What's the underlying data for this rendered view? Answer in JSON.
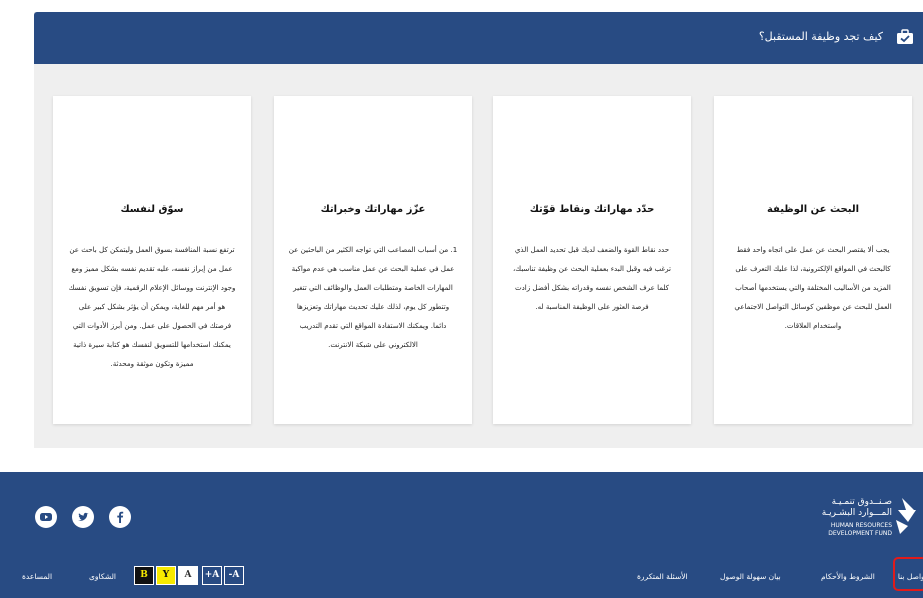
{
  "section": {
    "title": "كيف تجد وظيفة المستقبل؟",
    "icon": "briefcase-check-icon"
  },
  "cards": [
    {
      "title": "البحث عن الوظيفة",
      "body": "يجب ألا يقتصر البحث عن عمل على اتجاه واحد فقط كالبحث في المواقع الإلكترونية، لذا عليك التعرف على المزيد من الأساليب المختلفة والتي يستخدمها أصحاب العمل للبحث عن موظفين كوسائل التواصل الاجتماعي واستخدام العلاقات."
    },
    {
      "title": "حدّد مهاراتك ونقاط قوّتك",
      "body": "حدد نقاط القوة والضعف لديك قبل تحديد العمل الذي ترغب فيه وقبل البدء بعملية البحث عن وظيفة تناسبك، كلما عرف الشخص نفسه وقدراته بشكل أفضل زادت فرصة العثور على الوظيفة المناسبة له."
    },
    {
      "title": "عزّز مهاراتك وخبراتك",
      "body": "1. من أسباب المصاعب التي تواجه الكثير من الباحثين عن عمل في عملية البحث عن عمل مناسب هي عدم مواكبة المهارات الخاصة ومتطلبات العمل والوظائف التي تتغير وتتطور كل يوم، لذلك عليك تحديث مهاراتك وتعزيزها دائما. ويمكنك الاستفادة المواقع التي تقدم التدريب الالكتروني على شبكة الانترنت."
    },
    {
      "title": "سوّق لنفسك",
      "body": "ترتفع نسبة المنافسة بسوق العمل وليتمكن كل باحث عن عمل من إبراز نفسه، عليه تقديم نفسه بشكل مميز ومع وجود الإنترنت ووسائل الإعلام الرقمية، فإن تسويق نفسك هو أمر مهم للغاية، ويمكن أن يؤثر بشكل كبير على فرصتك في الحصول على عمل. ومن أبرز الأدوات التي يمكنك استخدامها للتسويق لنفسك هو كتابة سيرة ذاتية مميزة وتكون موثقة ومحدثة."
    }
  ],
  "footer": {
    "logo": {
      "ar_line1": "صـنــدوق تنمـيـة",
      "ar_line2": "المـــوارد البشـريـة",
      "en_line1": "HUMAN RESOURCES",
      "en_line2": "DEVELOPMENT FUND"
    },
    "social": [
      {
        "name": "youtube-icon"
      },
      {
        "name": "twitter-icon"
      },
      {
        "name": "facebook-icon"
      }
    ],
    "links": {
      "contact": "تواصل بنا",
      "terms": "الشروط والأحكام",
      "accessibility": "بيان سهولة الوصول",
      "faq": "الأسئلة المتكررة",
      "complaints": "الشكاوى",
      "help": "المساعدة"
    },
    "accessibility": {
      "contrast_black": "B",
      "contrast_yellow": "Y",
      "contrast_white": "A",
      "font_increase": "+A",
      "font_decrease": "-A"
    },
    "colors": {
      "primary": "#284b83",
      "highlight": "#e11b1b",
      "yellow": "#f7ea00"
    }
  }
}
